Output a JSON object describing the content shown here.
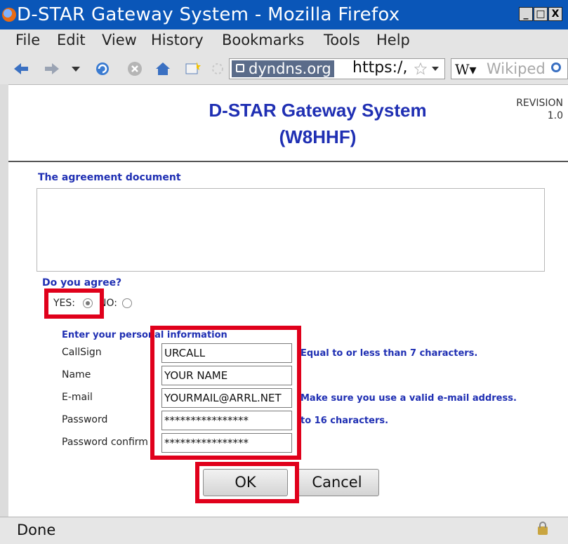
{
  "window": {
    "title": "D-STAR Gateway System - Mozilla Firefox",
    "min_label": "_",
    "max_label": "□",
    "close_label": "X"
  },
  "menu": {
    "items": [
      "File",
      "Edit",
      "View",
      "History",
      "Bookmarks",
      "Tools",
      "Help"
    ]
  },
  "toolbar": {
    "url_domain": "dyndns.org",
    "url_text": "https:/,",
    "search_engine": "W▾",
    "search_placeholder": "Wikiped"
  },
  "page": {
    "title_line1": "D-STAR Gateway System",
    "title_line2": "(W8HHF)",
    "revision_label": "REVISION",
    "revision_value": "1.0",
    "agreement_heading": "The agreement document",
    "agree_question": "Do you agree?",
    "yes_label": "YES:",
    "no_label": "NO:",
    "agree_selected": "YES",
    "personal_heading": "Enter your personal information",
    "fields": [
      {
        "label": "CallSign",
        "value": "URCALL",
        "hint": "Equal to or less than 7 characters."
      },
      {
        "label": "Name",
        "value": "YOUR NAME",
        "hint": ""
      },
      {
        "label": "E-mail",
        "value": "YOURMAIL@ARRL.NET",
        "hint": "Make sure you use a valid e-mail address."
      },
      {
        "label": "Password",
        "value": "****************",
        "hint": "to 16 characters."
      },
      {
        "label": "Password confirm",
        "value": "****************",
        "hint": ""
      }
    ],
    "ok_label": "OK",
    "cancel_label": "Cancel"
  },
  "status": {
    "text": "Done"
  },
  "colors": {
    "titlebar": "#0a56b8",
    "heading_blue": "#1f2fb3",
    "highlight_red": "#e0001b"
  },
  "icons": [
    "back-icon",
    "forward-icon",
    "dropdown-icon",
    "reload-icon",
    "stop-icon",
    "home-icon",
    "bookmark-icon",
    "site-identity-icon",
    "star-icon",
    "search-icon",
    "lock-icon"
  ]
}
